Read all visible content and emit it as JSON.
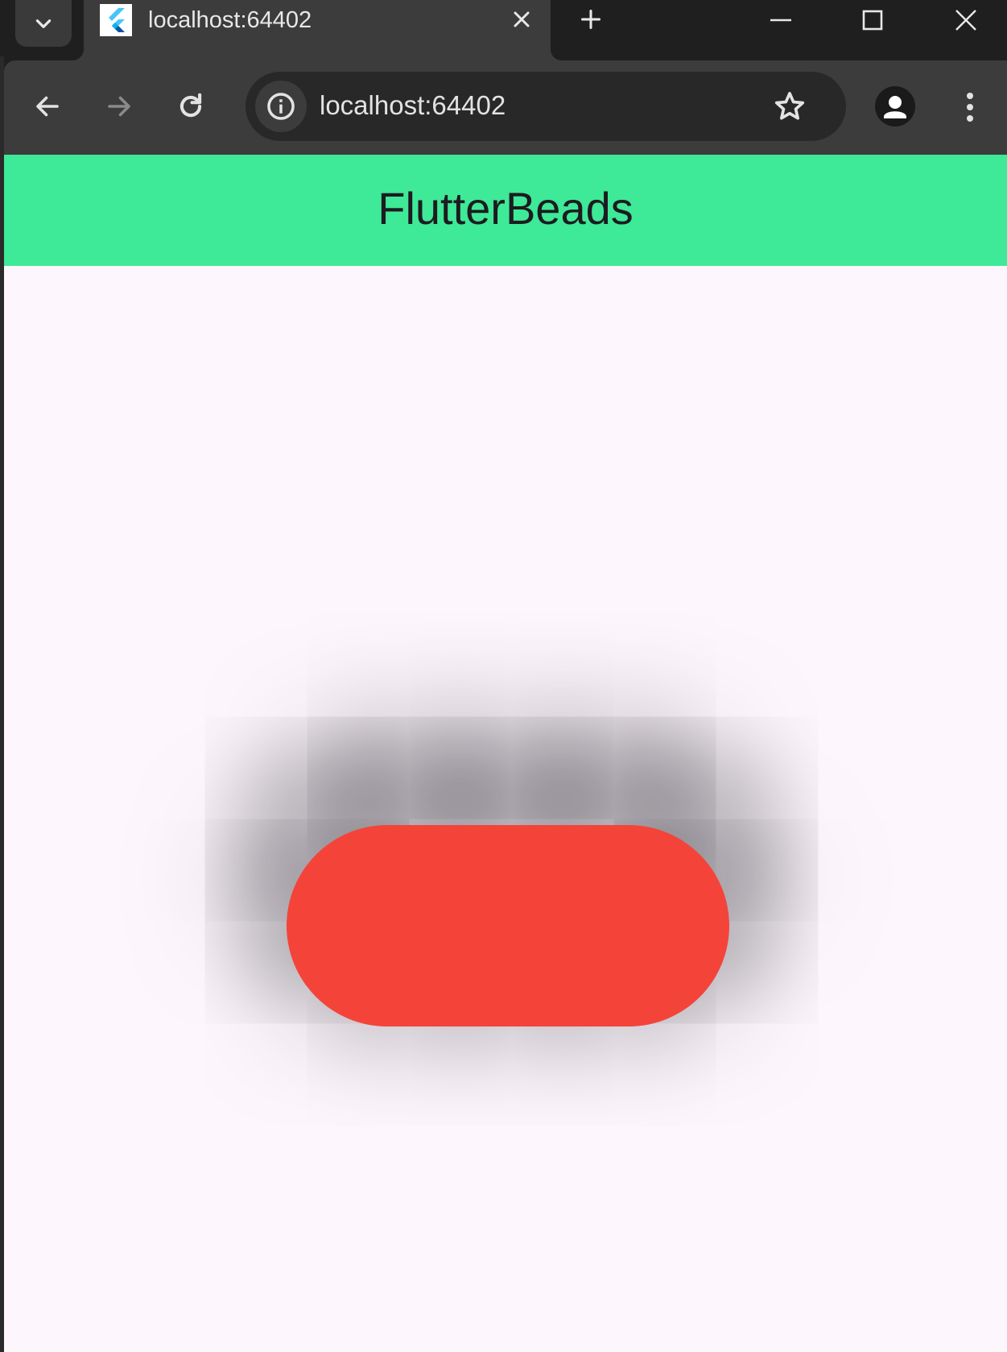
{
  "browser": {
    "tab": {
      "title": "localhost:64402",
      "favicon": "flutter-logo-icon"
    },
    "address_bar": {
      "url": "localhost:64402"
    },
    "icons": {
      "tab_search": "chevron-down-icon",
      "tab_close": "close-icon",
      "new_tab": "plus-icon",
      "minimize": "minimize-icon",
      "maximize": "maximize-icon",
      "close_window": "close-icon",
      "back": "arrow-left-icon",
      "forward": "arrow-right-icon",
      "reload": "reload-icon",
      "site_info": "info-icon",
      "bookmark": "star-icon",
      "profile": "person-icon",
      "menu": "more-vertical-icon"
    }
  },
  "app": {
    "title": "FlutterBeads",
    "colors": {
      "appbar": "#3ee997",
      "background": "#fdf7fd",
      "bead": "#f4443a"
    }
  }
}
